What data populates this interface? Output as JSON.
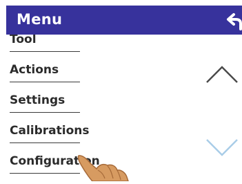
{
  "header": {
    "title": "Menu",
    "back_icon": "back-arrow-icon",
    "background": "#37329c"
  },
  "menu": {
    "items": [
      {
        "label": "Tool"
      },
      {
        "label": "Actions"
      },
      {
        "label": "Settings"
      },
      {
        "label": "Calibrations"
      },
      {
        "label": "Configuration"
      }
    ]
  },
  "scroll": {
    "up_icon": "chevron-up-icon",
    "down_icon": "chevron-down-icon"
  },
  "overlay": {
    "icon": "pointing-hand-icon"
  }
}
